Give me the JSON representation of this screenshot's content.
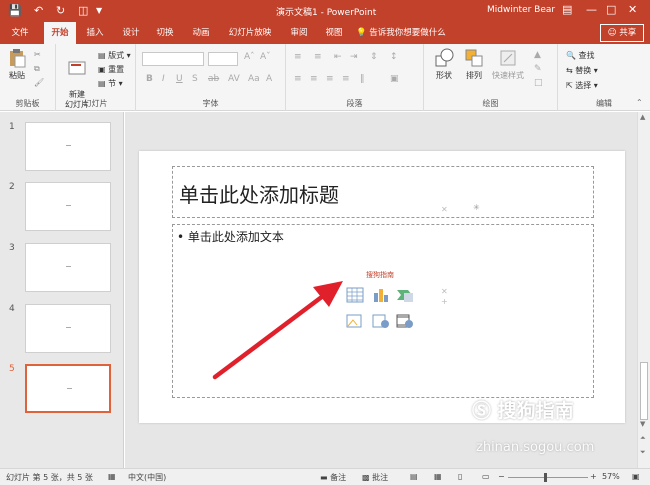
{
  "titlebar": {
    "title": "演示文稿1 - PowerPoint",
    "user": "Midwinter Bear"
  },
  "tabs": [
    "文件",
    "开始",
    "插入",
    "设计",
    "切换",
    "动画",
    "幻灯片放映",
    "审阅",
    "视图"
  ],
  "tell_me": "告诉我你想要做什么",
  "share": "共享",
  "ribbon": {
    "clipboard": {
      "label": "剪贴板",
      "paste": "粘贴"
    },
    "slides": {
      "label": "幻灯片",
      "new_slide": "新建\n幻灯片",
      "layout": "版式",
      "reset": "重置",
      "section": "节"
    },
    "font": {
      "label": "字体"
    },
    "paragraph": {
      "label": "段落"
    },
    "drawing": {
      "label": "绘图",
      "shapes": "形状",
      "arrange": "排列",
      "quick_styles": "快速样式"
    },
    "editing": {
      "label": "编辑",
      "find": "查找",
      "replace": "替换",
      "select": "选择"
    }
  },
  "thumbnails": [
    "1",
    "2",
    "3",
    "4",
    "5"
  ],
  "slide": {
    "title_placeholder": "单击此处添加标题",
    "body_placeholder": "• 单击此处添加文本",
    "overlay_text": "搜狗指南"
  },
  "status": {
    "slide_info": "幻灯片 第 5 张，共 5 张",
    "language": "中文(中国)",
    "notes": "备注",
    "comments": "批注",
    "zoom": "57%"
  },
  "watermark": {
    "brand": "搜狗指南",
    "url": "zhinan.sogou.com"
  },
  "colors": {
    "accent": "#c2412b",
    "arrow": "#e0202a"
  }
}
